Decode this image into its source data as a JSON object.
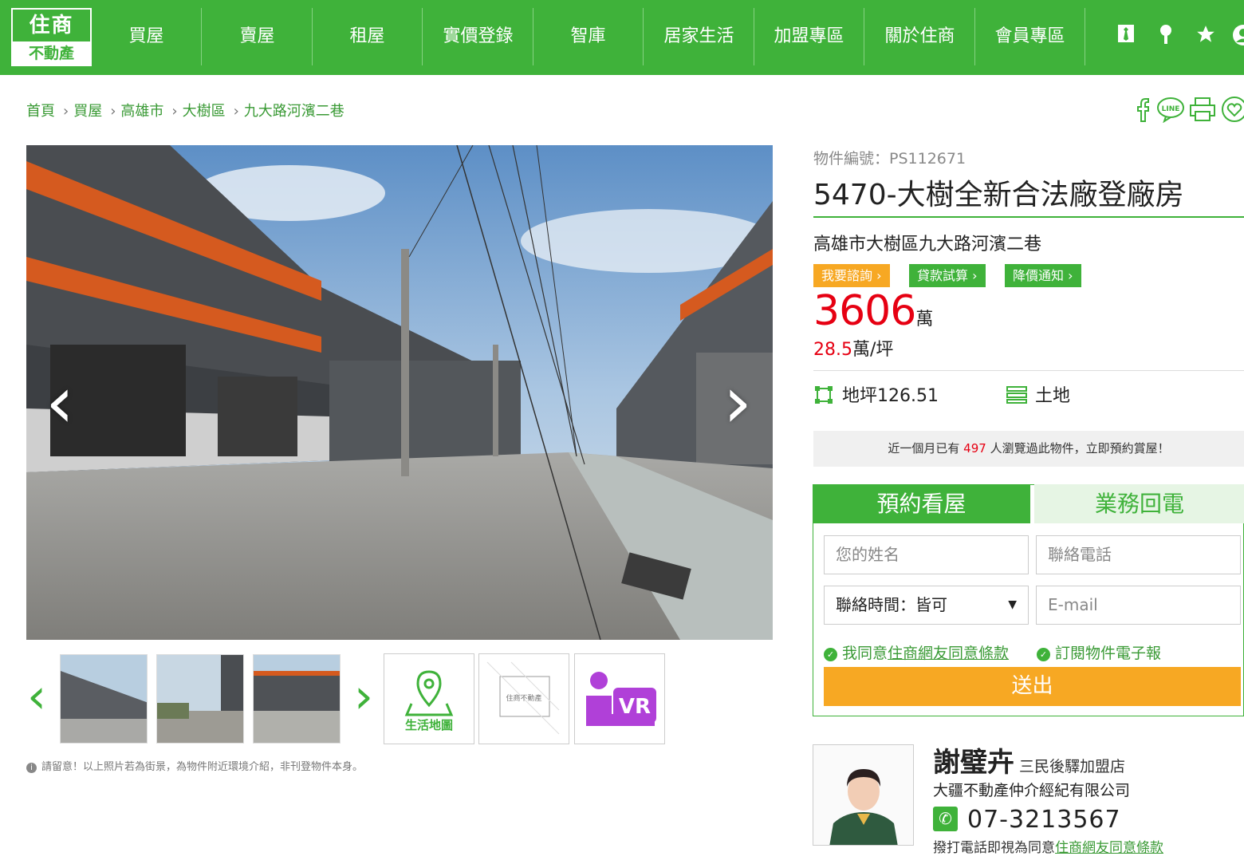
{
  "brand": {
    "logo_top": "住商",
    "logo_bottom": "不動產",
    "green": "#3fb23a",
    "red": "#e60012",
    "orange": "#f7a823"
  },
  "nav": {
    "items": [
      "買屋",
      "賣屋",
      "租屋",
      "實價登錄",
      "智庫",
      "居家生活",
      "加盟專區",
      "關於住商",
      "會員專區"
    ],
    "icons": [
      "tie-icon",
      "pin-icon",
      "star-icon",
      "user-icon"
    ]
  },
  "breadcrumb": [
    "首頁",
    "買屋",
    "高雄市",
    "大樹區",
    "九大路河濱二巷"
  ],
  "share_icons": [
    "facebook-icon",
    "line-icon",
    "print-icon",
    "heart-icon"
  ],
  "share": {
    "line_label": "LINE"
  },
  "thumbs": {
    "map_label": "生活地圖",
    "vr_label": "VR",
    "watermark": "住商不動產"
  },
  "notice": "請留意！以上照片若為街景，為物件附近環境介紹，非刊登物件本身。",
  "listing": {
    "id_label": "物件編號：PS112671",
    "title": "5470-大樹全新合法廠登廠房",
    "address": "高雄市大樹區九大路河濱二巷",
    "tags": [
      {
        "label": "我要諮詢",
        "color": "#f7a823"
      },
      {
        "label": "貸款試算",
        "color": "#3fb23a"
      },
      {
        "label": "降價通知",
        "color": "#3fb23a"
      }
    ],
    "price": "3606",
    "price_unit": "萬",
    "unit_price": "28.5",
    "unit_price_unit": "萬/坪",
    "spec_area": "地坪126.51",
    "spec_type": "土地",
    "views_before": "近一個月已有 ",
    "views_count": "497",
    "views_after": " 人瀏覽過此物件，立即預約賞屋！"
  },
  "form": {
    "tab_active": "預約看屋",
    "tab_inactive": "業務回電",
    "name_placeholder": "您的姓名",
    "phone_placeholder": "聯絡電話",
    "time_select": "聯絡時間：皆可",
    "email_placeholder": "E-mail",
    "agree_prefix": "我同意",
    "agree_link": "住商網友同意條款",
    "subscribe": "訂閱物件電子報",
    "submit": "送出"
  },
  "agent": {
    "name": "謝璧卉",
    "store": "三民後驛加盟店",
    "company": "大疆不動產仲介經紀有限公司",
    "phone": "07-3213567",
    "note_prefix": "撥打電話即視為同意",
    "note_link": "住商網友同意條款"
  }
}
